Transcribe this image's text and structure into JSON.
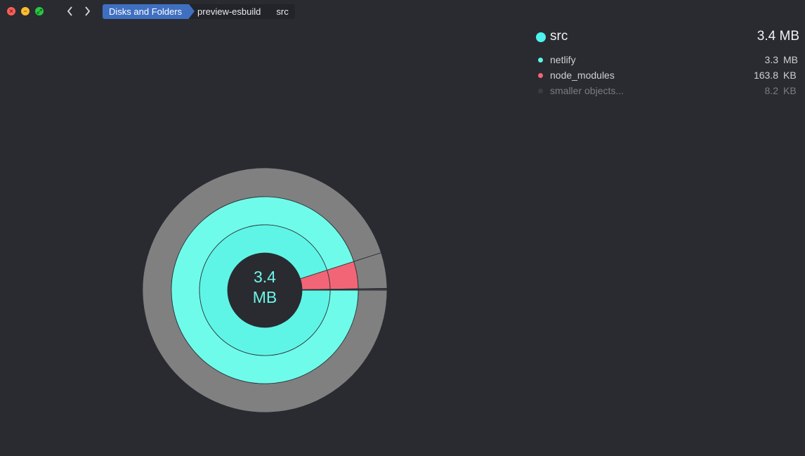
{
  "window": {
    "buttons": {
      "close": "close",
      "minimize": "minimize",
      "maximize": "maximize"
    }
  },
  "nav": {
    "back_icon": "chevron-left-icon",
    "forward_icon": "chevron-right-icon"
  },
  "breadcrumb": [
    "Disks and Folders",
    "preview-esbuild",
    "src"
  ],
  "legend": {
    "title": "src",
    "title_size": "3.4 MB",
    "title_color": "#4df2ee",
    "items": [
      {
        "name": "netlify",
        "num": "3.3",
        "unit": "MB",
        "color": "#5ff5e6",
        "dim": false
      },
      {
        "name": "node_modules",
        "num": "163.8",
        "unit": "KB",
        "color": "#f26577",
        "dim": false
      },
      {
        "name": "smaller objects...",
        "num": "8.2",
        "unit": "KB",
        "color": "#3a3c42",
        "dim": true
      }
    ]
  },
  "chart": {
    "center_value": "3.4",
    "center_unit": "MB",
    "colors": {
      "netlify_inner": "#5ff5e6",
      "netlify_middle": "#6ffbea",
      "node_modules": "#f26577",
      "outer_ring": "#808080",
      "hole": "#292b31",
      "stroke": "#2a2c32",
      "tiny_slice": "#3a3c42"
    }
  },
  "chart_data": {
    "type": "pie",
    "title": "src",
    "categories": [
      "netlify",
      "node_modules",
      "smaller objects..."
    ],
    "values": [
      3.3,
      0.1638,
      0.0082
    ],
    "unit": "MB",
    "total": "3.4 MB"
  }
}
